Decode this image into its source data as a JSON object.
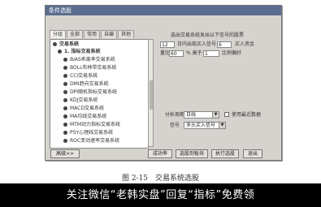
{
  "window": {
    "title": "条件选股"
  },
  "tabs": [
    "分组",
    "全部",
    "常用",
    "自编",
    "其他"
  ],
  "tree": {
    "root": "交易系统",
    "category": "1. 指标交易系统",
    "items": [
      "BIAS乖离率交易系统",
      "BOLL布林带交易系统",
      "CCI交易系统",
      "DMI趋向交易系统",
      "DPI随机指标交易系统",
      "KDJ交易系统",
      "MACD交易系统",
      "MA均线交易系统",
      "MTM动力指标交易系统",
      "PSY心理线交易系统",
      "ROC变动速率交易系统"
    ]
  },
  "right_panel": {
    "description": "选出交易系统发出以下信号的股票",
    "buy_period_value": "12",
    "buy_period_label": "日内出现买入信号",
    "buy_signal_value": "6",
    "buy_signal_label": "买入资金",
    "volume_label": "量比",
    "volume_value": "60",
    "ratio_label": "% 高于",
    "ratio_value": "1",
    "ratio_suffix": "比例偏好",
    "period_label": "分析周期",
    "period_value": "日线",
    "recent_label": "使用最近数据",
    "signal_label": "信号",
    "signal_value": "多头买入信号"
  },
  "buttons": {
    "advanced": "高级>>",
    "success": "成功率",
    "select_to_block": "选股到板块",
    "execute": "执行选股",
    "exit": "退出"
  },
  "caption": "图 2-15　交易系统选股",
  "banner": "关注微信“老韩实盘”回复“指标”免费领"
}
